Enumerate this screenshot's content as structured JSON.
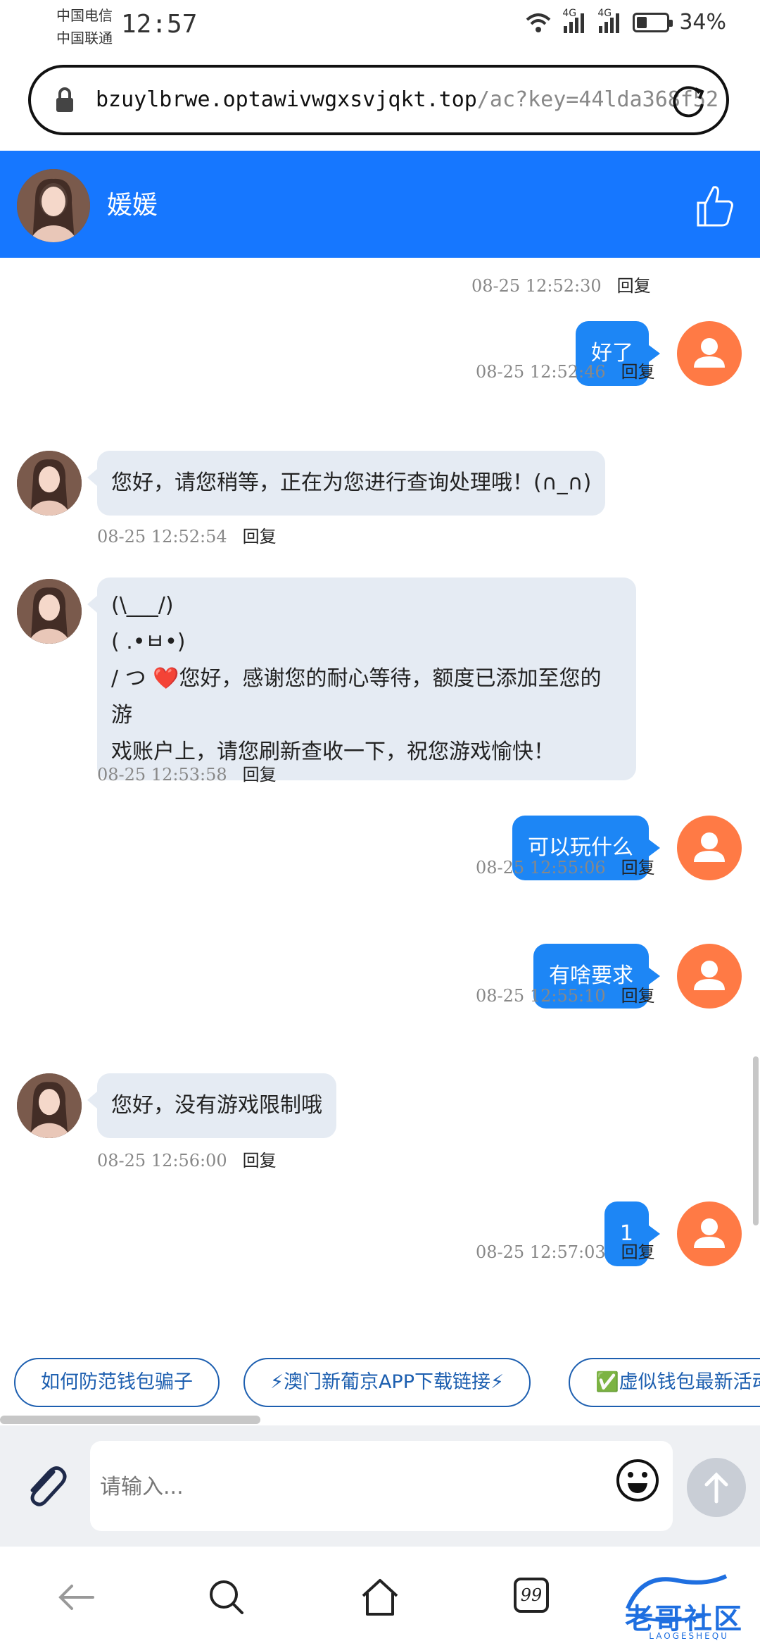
{
  "status_bar": {
    "carrier_1": "中国电信",
    "carrier_2": "中国联通",
    "time": "12:57",
    "net_1": "4G",
    "net_2": "4G",
    "battery_text": "34%",
    "battery_level": 0.34
  },
  "browser": {
    "url_host": "bzuylbrwe.optawivwgxsvjqkt.top",
    "url_path": "/ac?key=44lda368f52"
  },
  "chat": {
    "contact_name": "媛媛",
    "accent": "#1677ff",
    "messages": [
      {
        "side": "meta-only",
        "time": "08-25 12:52:30",
        "reply": "回复"
      },
      {
        "side": "right",
        "text": "好了",
        "time": "08-25 12:52:46",
        "reply": "回复"
      },
      {
        "side": "left",
        "text": "您好，请您稍等，正在为您进行查询处理哦！(∩_∩)",
        "time": "08-25 12:52:54",
        "reply": "回复"
      },
      {
        "side": "left",
        "lines": [
          "(\\___/)",
          "( .•ㅂ•)",
          "/ つ ❤️您好，感谢您的耐心等待，额度已添加至您的游",
          "戏账户上，请您刷新查收一下，祝您游戏愉快！"
        ],
        "time": "08-25 12:53:58",
        "reply": "回复"
      },
      {
        "side": "right",
        "text": "可以玩什么",
        "time": "08-25 12:55:06",
        "reply": "回复"
      },
      {
        "side": "right",
        "text": "有啥要求",
        "time": "08-25 12:55:10",
        "reply": "回复"
      },
      {
        "side": "left",
        "text": "您好，没有游戏限制哦",
        "time": "08-25 12:56:00",
        "reply": "回复"
      },
      {
        "side": "right",
        "text": "1",
        "time": "08-25 12:57:03",
        "reply": "回复"
      }
    ]
  },
  "quick_replies": [
    "如何防范钱包骗子",
    "⚡澳门新葡京APP下载链接⚡",
    "✅虚似钱包最新活动"
  ],
  "input": {
    "placeholder": "请输入..."
  },
  "watermark": {
    "text": "老哥社区",
    "sub": "LAOGESHEQU"
  }
}
